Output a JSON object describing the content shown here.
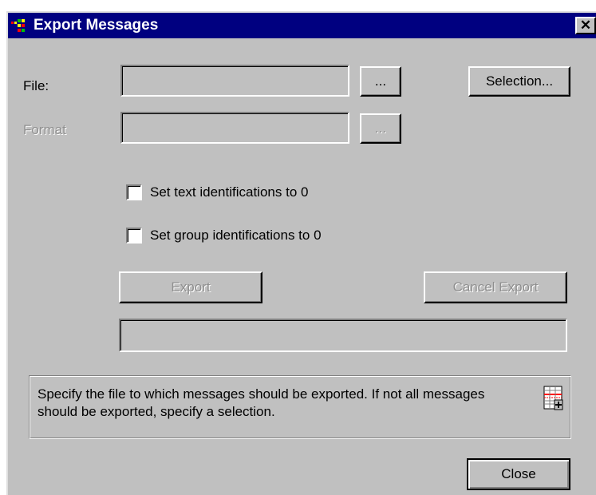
{
  "window": {
    "title": "Export Messages",
    "close_glyph": "✕"
  },
  "form": {
    "file_label": "File:",
    "file_value": "",
    "file_browse_label": "...",
    "selection_button_label": "Selection...",
    "format_label": "Format",
    "format_value": "",
    "format_browse_label": "..."
  },
  "options": {
    "set_text_ids_label": "Set text identifications to 0",
    "set_text_ids_checked": false,
    "set_group_ids_label": "Set group identifications to 0",
    "set_group_ids_checked": false
  },
  "actions": {
    "export_label": "Export",
    "cancel_export_label": "Cancel Export",
    "status_text": ""
  },
  "info": {
    "text": "Specify the file to which messages should be exported. If not all messages should be exported, specify a selection.",
    "icon": "export-table-icon"
  },
  "footer": {
    "close_label": "Close"
  },
  "colors": {
    "titlebar": "#000080",
    "dialog_face": "#c0c0c0",
    "disabled_text": "#8f8f8f"
  }
}
